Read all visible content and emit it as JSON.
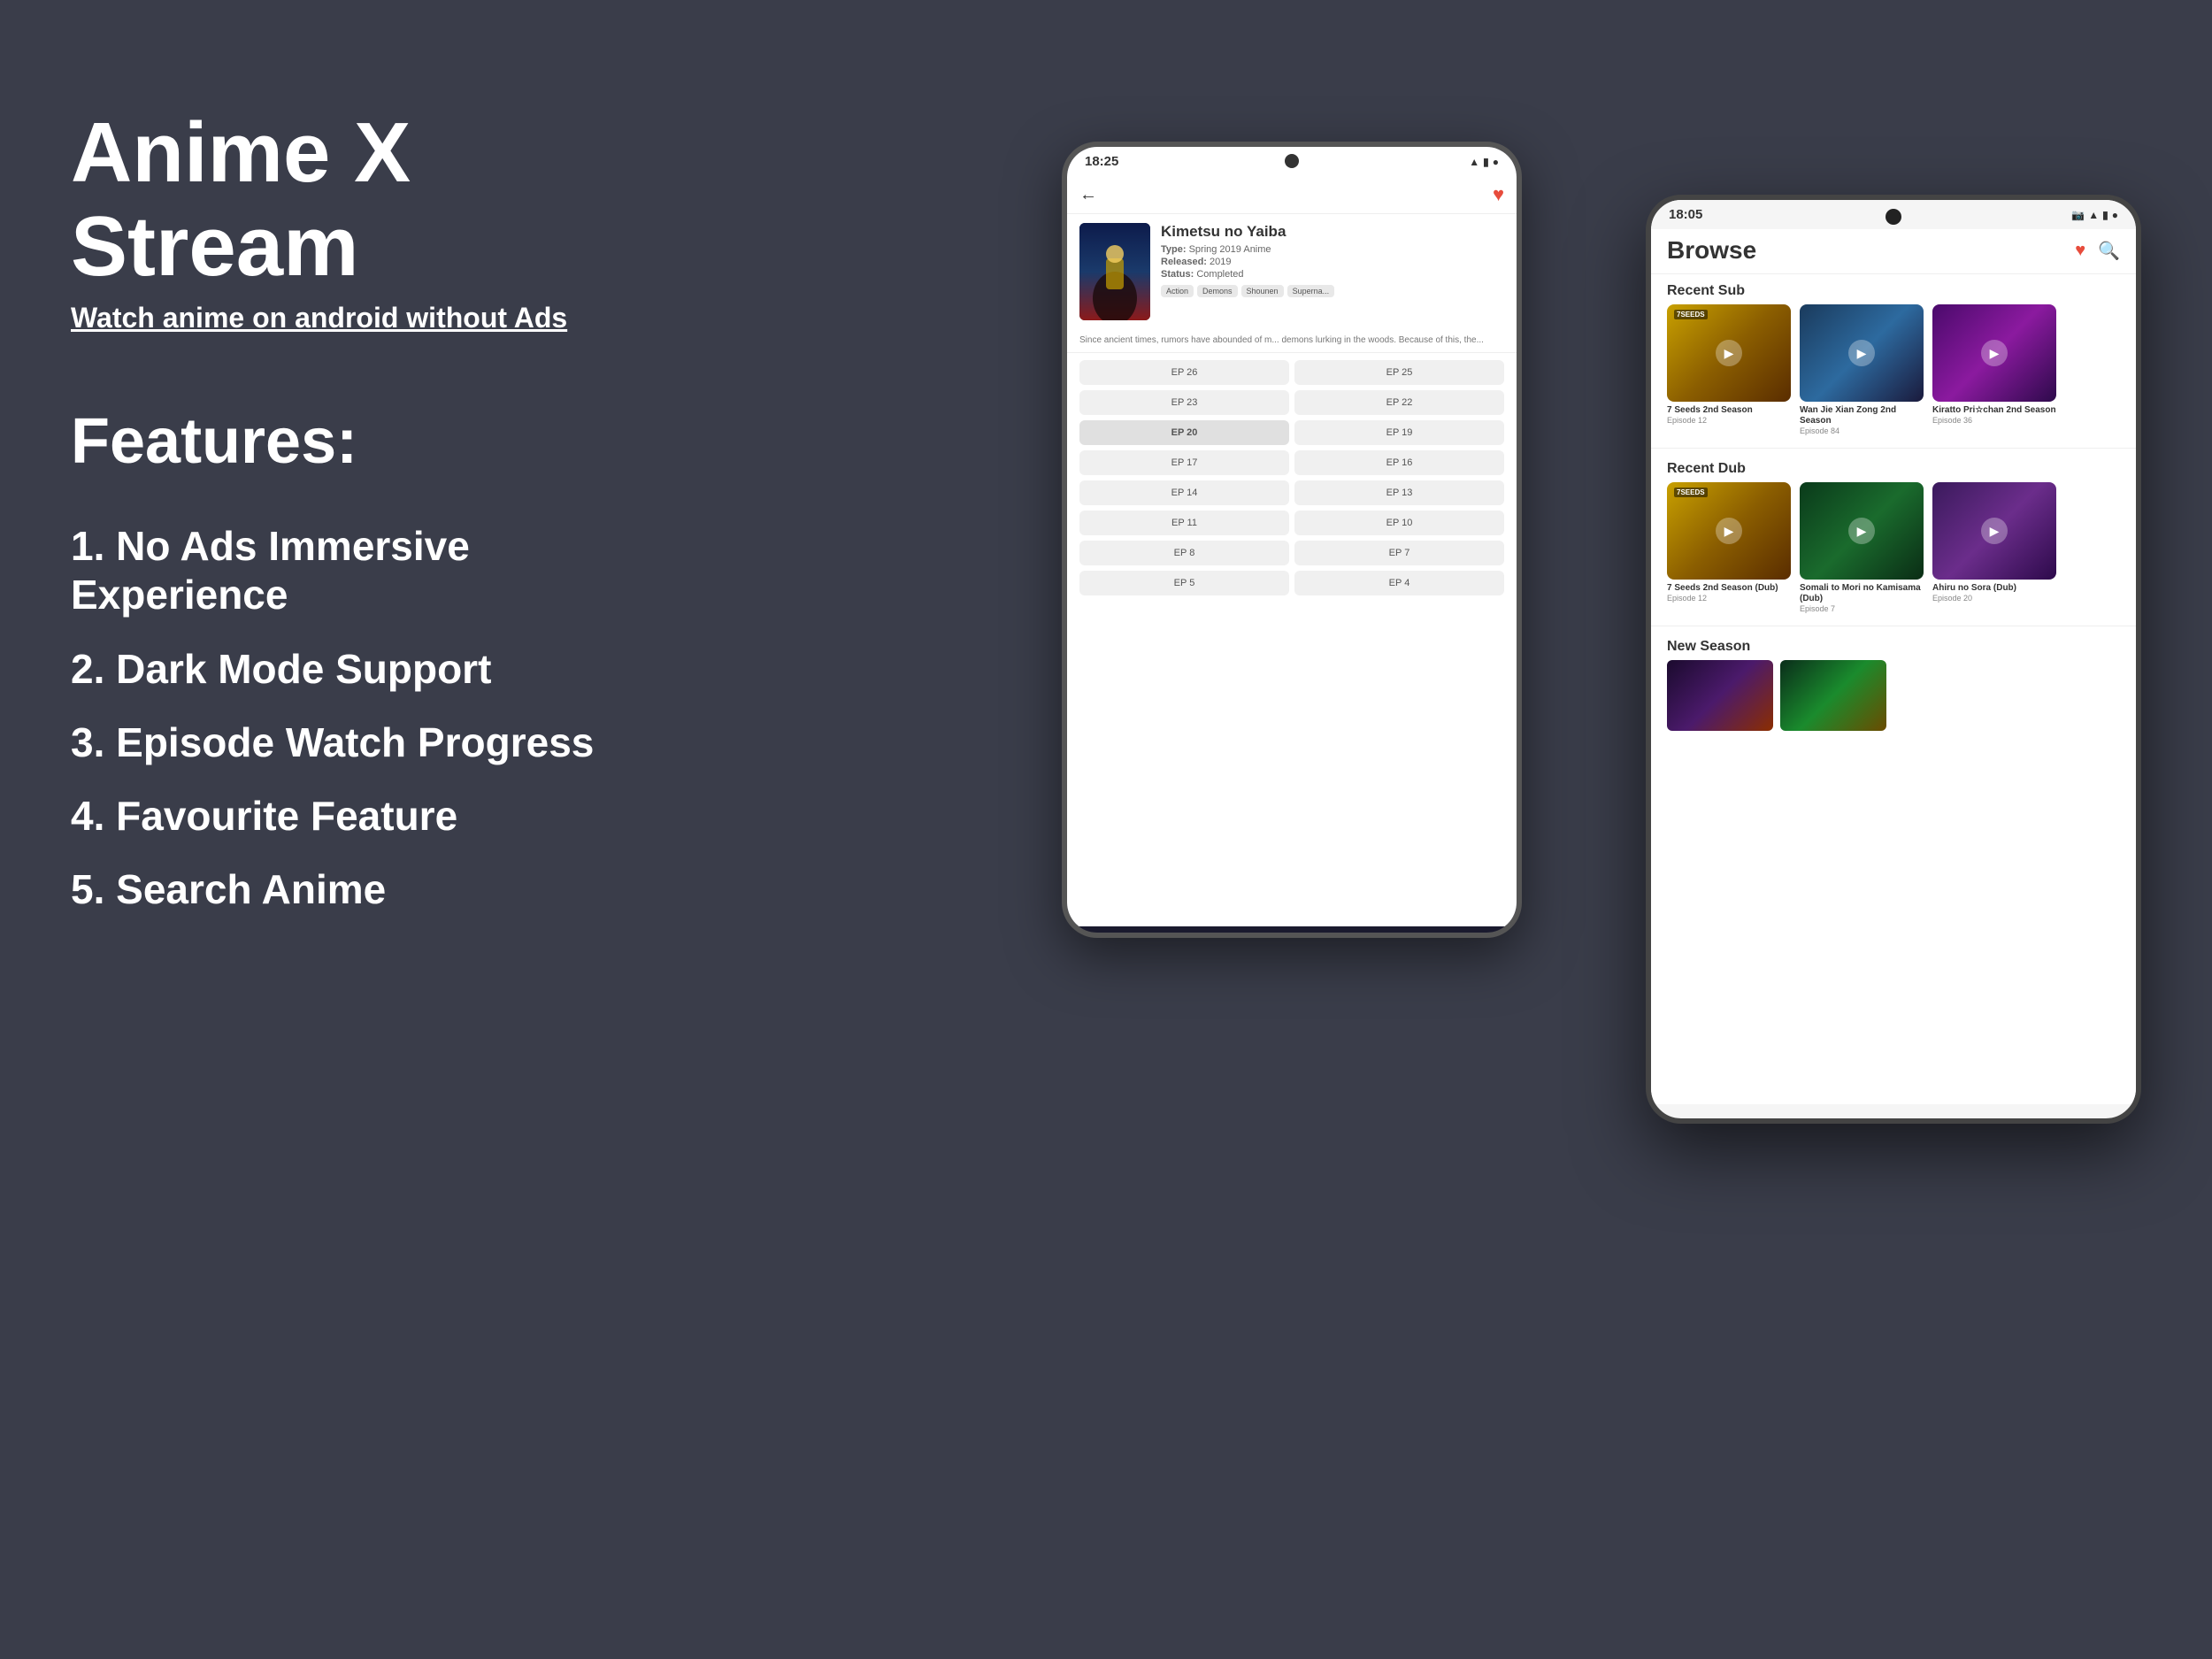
{
  "app": {
    "title": "Anime X Stream",
    "subtitle": "Watch anime on android without Ads",
    "background_color": "#3a3d4a"
  },
  "features": {
    "heading": "Features:",
    "items": [
      {
        "number": "1.",
        "text": "No Ads Immersive Experience"
      },
      {
        "number": "2.",
        "text": "Dark Mode Support"
      },
      {
        "number": "3.",
        "text": "Episode Watch Progress"
      },
      {
        "number": "4.",
        "text": "Favourite Feature"
      },
      {
        "number": "5.",
        "text": "Search Anime"
      }
    ]
  },
  "phone_back": {
    "status_time": "18:25",
    "status_icons": "▲ ■ ●",
    "anime_title": "Kimetsu no Yaiba",
    "anime_type": "Spring 2019 Anime",
    "anime_released": "2019",
    "anime_status": "Completed",
    "tags": [
      "Action",
      "Demons",
      "Shounen",
      "Superna..."
    ],
    "description": "Since ancient times, rumors have abounded of m... demons lurking in the woods. Because of this, the...",
    "episodes": [
      "EP 26",
      "EP 25",
      "EP 23",
      "EP 22",
      "EP 20",
      "EP 19",
      "EP 17",
      "EP 16",
      "EP 14",
      "EP 13",
      "EP 11",
      "EP 10",
      "EP 8",
      "EP 7",
      "EP 5",
      "EP 4"
    ]
  },
  "phone_front": {
    "status_time": "18:05",
    "status_icons": "📷 ▲ ■ ●",
    "browse_title": "Browse",
    "recent_sub_label": "Recent Sub",
    "recent_dub_label": "Recent Dub",
    "new_season_label": "New Season",
    "sub_anime": [
      {
        "title": "7 Seeds 2nd Season",
        "episode": "Episode 12"
      },
      {
        "title": "Wan Jie Xian Zong 2nd Season",
        "episode": "Episode 84"
      },
      {
        "title": "Kiratto Pri☆chan 2nd Season",
        "episode": "Episode 36"
      }
    ],
    "dub_anime": [
      {
        "title": "7 Seeds 2nd Season (Dub)",
        "episode": "Episode 12"
      },
      {
        "title": "Somali to Mori no Kamisama (Dub)",
        "episode": "Episode 7"
      },
      {
        "title": "Ahiru no Sora (Dub)",
        "episode": "Episode 20"
      }
    ]
  }
}
